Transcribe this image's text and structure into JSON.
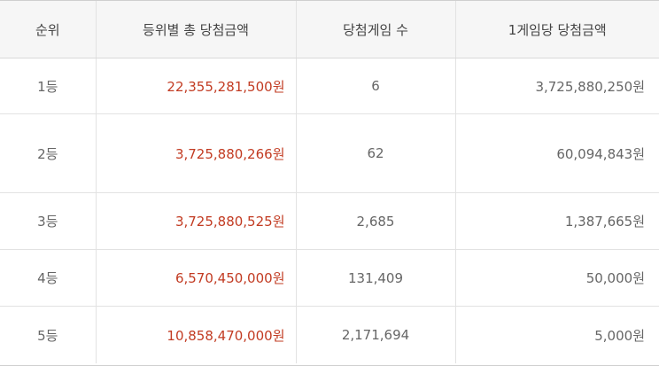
{
  "table": {
    "headers": {
      "rank": "순위",
      "total": "등위별 총 당첨금액",
      "games": "당첨게임 수",
      "per_game": "1게임당 당첨금액"
    },
    "rows": [
      {
        "rank": "1등",
        "total": "22,355,281,500원",
        "games": "6",
        "per_game": "3,725,880,250원"
      },
      {
        "rank": "2등",
        "total": "3,725,880,266원",
        "games": "62",
        "per_game": "60,094,843원"
      },
      {
        "rank": "3등",
        "total": "3,725,880,525원",
        "games": "2,685",
        "per_game": "1,387,665원"
      },
      {
        "rank": "4등",
        "total": "6,570,450,000원",
        "games": "131,409",
        "per_game": "50,000원"
      },
      {
        "rank": "5등",
        "total": "10,858,470,000원",
        "games": "2,171,694",
        "per_game": "5,000원"
      }
    ]
  },
  "colors": {
    "total_amount": "#c23b22",
    "header_bg": "#f6f6f6",
    "text": "#666666"
  }
}
